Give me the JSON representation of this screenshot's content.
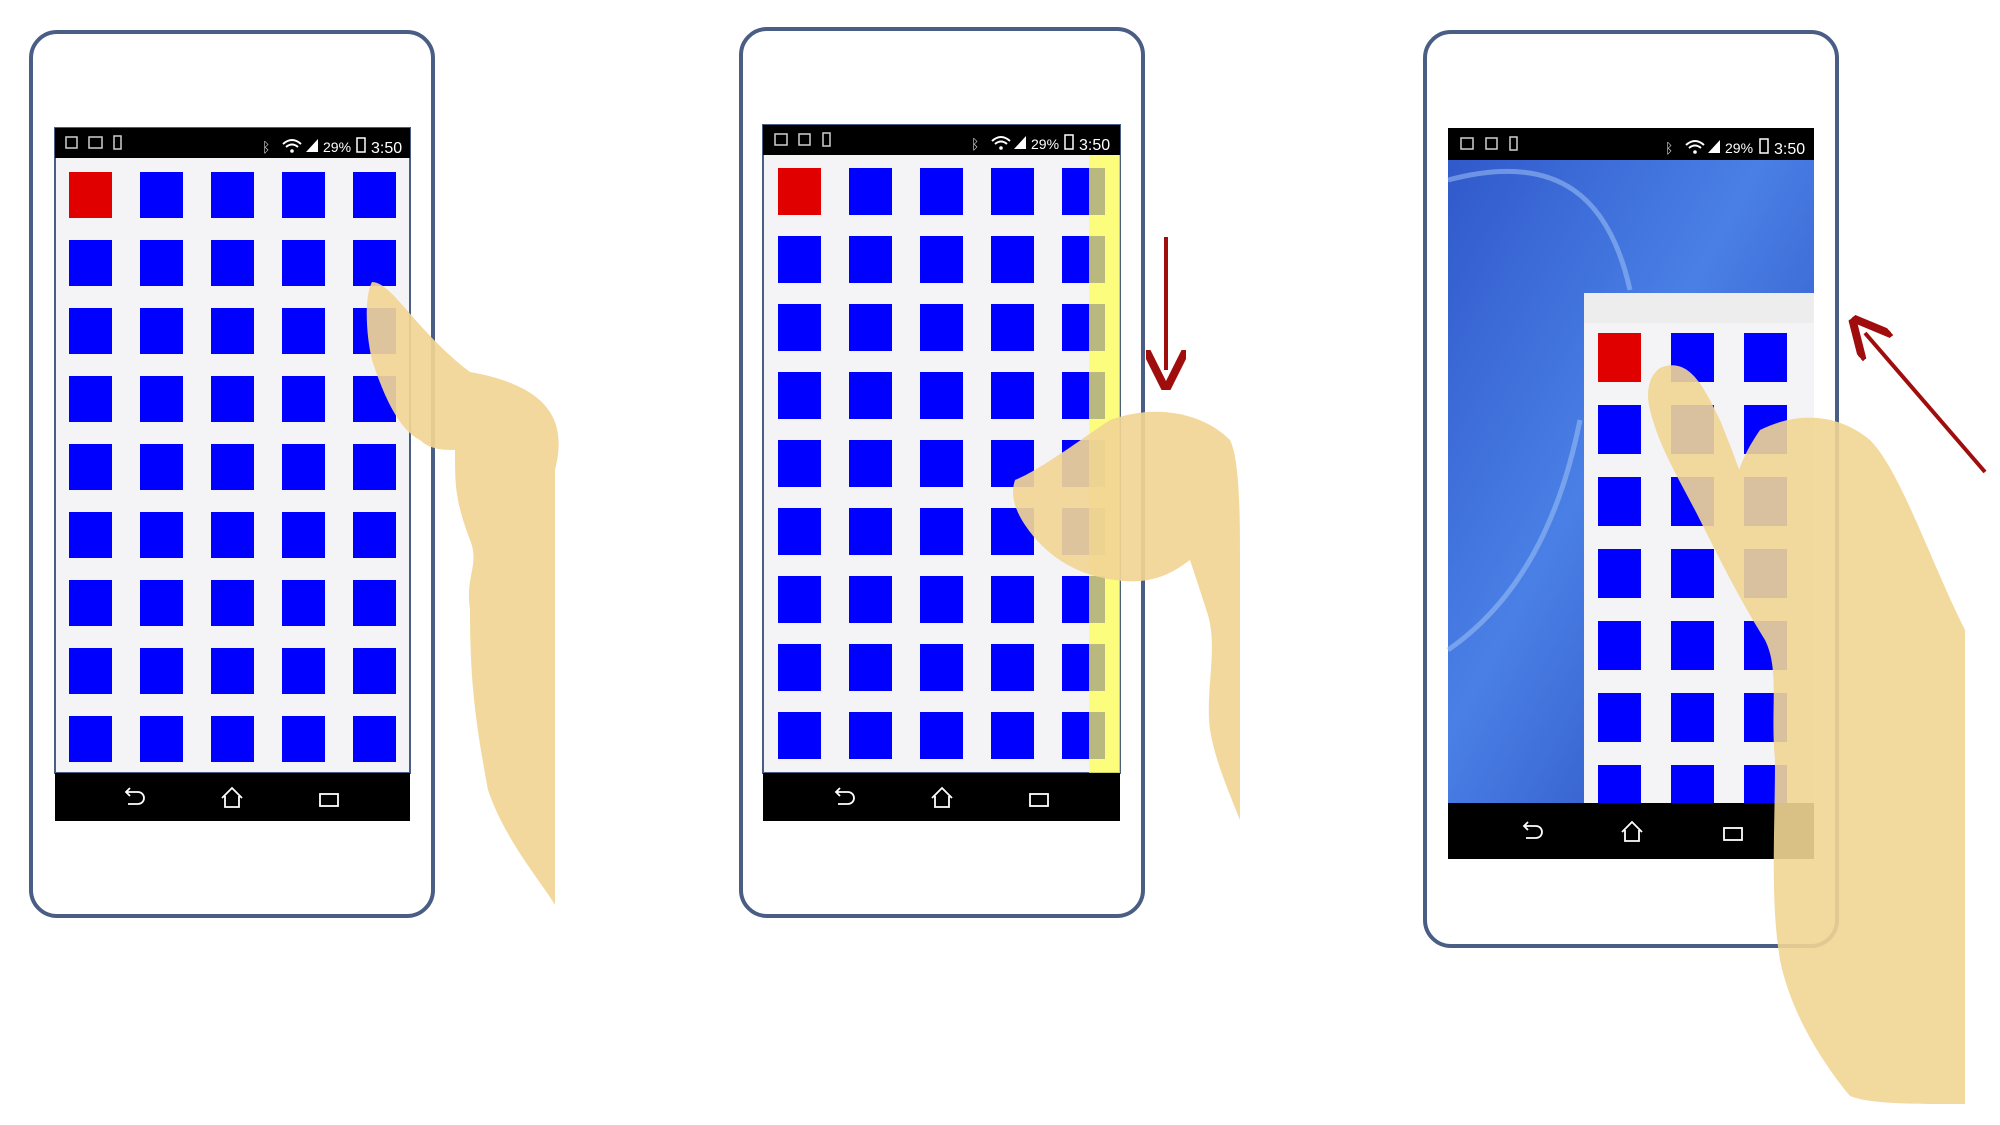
{
  "status_bar": {
    "battery_percent": "29%",
    "time": "3:50"
  },
  "nav_bar": {
    "icons": [
      "back-icon",
      "home-icon",
      "recent-apps-icon"
    ]
  },
  "grid": {
    "rows": 9,
    "cols": 5,
    "highlight_row": 0,
    "highlight_col": 0
  },
  "colors": {
    "tile_blue": "#0000FF",
    "tile_red": "#E00000",
    "bar_black": "#000000",
    "phone_border": "#4A5E85",
    "screen_bg": "#F4F4F6",
    "edge_highlight": "#FFFF4D",
    "hand": "#F1D594",
    "arrow": "#A00D0D",
    "wallpaper_blue": "#3F74DE"
  },
  "panels": [
    {
      "name": "phone-panel-tap-edge",
      "gesture": "tap-right-edge"
    },
    {
      "name": "phone-panel-swipe-down-edge",
      "gesture": "swipe-down-right-edge",
      "arrow_direction": "down"
    },
    {
      "name": "phone-panel-reduced-screen",
      "gesture": "reachability-shrunk-view",
      "arrow_direction": "up-right"
    }
  ]
}
